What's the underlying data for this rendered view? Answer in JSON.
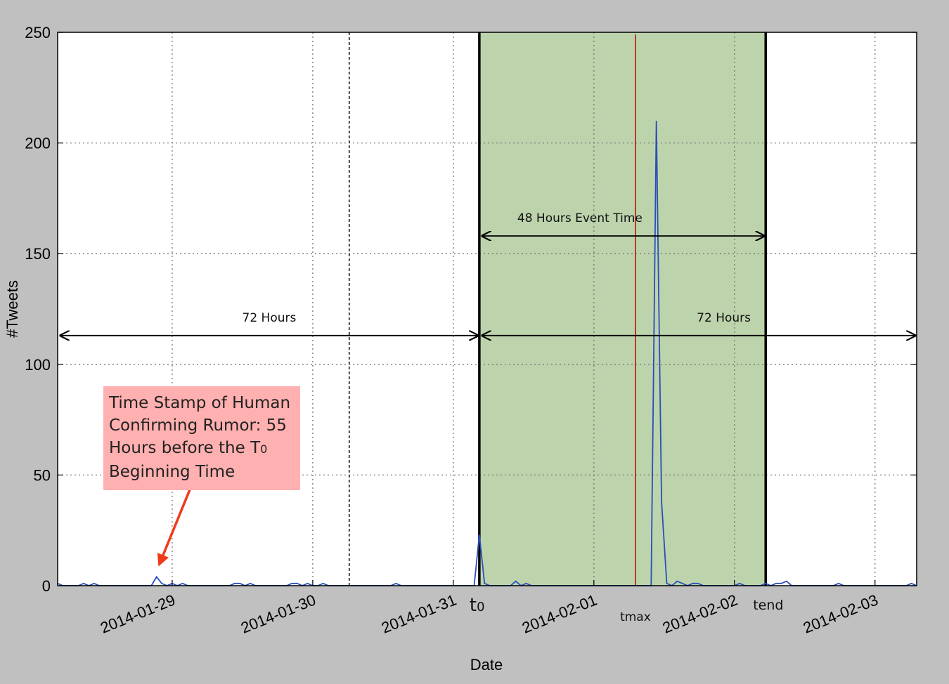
{
  "chart_data": {
    "type": "line",
    "title": "",
    "xlabel": "Date",
    "ylabel": "#Tweets",
    "ylim": [
      0,
      250
    ],
    "yticks": [
      0,
      50,
      100,
      150,
      200,
      250
    ],
    "xlim_hours": [
      0,
      165
    ],
    "xticks": [
      {
        "label": "2014-01-29",
        "hour": 22
      },
      {
        "label": "2014-01-30",
        "hour": 49
      },
      {
        "label": "2014-01-31",
        "hour": 76
      },
      {
        "label": "2014-02-01",
        "hour": 103
      },
      {
        "label": "2014-02-02",
        "hour": 130
      },
      {
        "label": "2014-02-03",
        "hour": 157
      }
    ],
    "grid": true,
    "series": [
      {
        "name": "",
        "color": "#2a4fb8",
        "x": [
          0,
          1,
          2,
          3,
          4,
          5,
          6,
          7,
          8,
          9,
          10,
          11,
          12,
          13,
          14,
          15,
          16,
          17,
          18,
          19,
          20,
          21,
          22,
          23,
          24,
          25,
          26,
          27,
          28,
          29,
          30,
          31,
          32,
          33,
          34,
          35,
          36,
          37,
          38,
          39,
          40,
          41,
          42,
          43,
          44,
          45,
          46,
          47,
          48,
          49,
          50,
          51,
          52,
          53,
          54,
          55,
          56,
          57,
          58,
          59,
          60,
          61,
          62,
          63,
          64,
          65,
          66,
          67,
          68,
          69,
          70,
          71,
          72,
          73,
          74,
          75,
          76,
          77,
          78,
          79,
          80,
          81,
          82,
          83,
          84,
          85,
          86,
          87,
          88,
          89,
          90,
          91,
          92,
          93,
          94,
          95,
          96,
          97,
          98,
          99,
          100,
          101,
          102,
          103,
          104,
          105,
          106,
          107,
          108,
          109,
          110,
          111,
          112,
          113,
          114,
          115,
          116,
          117,
          118,
          119,
          120,
          121,
          122,
          123,
          124,
          125,
          126,
          127,
          128,
          129,
          130,
          131,
          132,
          133,
          134,
          135,
          136,
          137,
          138,
          139,
          140,
          141,
          142,
          143,
          144,
          145,
          146,
          147,
          148,
          149,
          150,
          151,
          152,
          153,
          154,
          155,
          156,
          157,
          158,
          159,
          160,
          161,
          162,
          163,
          164,
          165
        ],
        "y": [
          1,
          0,
          0,
          0,
          0,
          1,
          0,
          1,
          0,
          0,
          0,
          0,
          0,
          0,
          0,
          0,
          0,
          0,
          0,
          4,
          1,
          0,
          1,
          0,
          1,
          0,
          0,
          0,
          0,
          0,
          0,
          0,
          0,
          0,
          1,
          1,
          0,
          1,
          0,
          0,
          0,
          0,
          0,
          0,
          0,
          1,
          1,
          0,
          1,
          0,
          0,
          1,
          0,
          0,
          0,
          0,
          0,
          0,
          0,
          0,
          0,
          0,
          0,
          0,
          0,
          1,
          0,
          0,
          0,
          0,
          0,
          0,
          0,
          0,
          0,
          0,
          0,
          0,
          0,
          0,
          0,
          23,
          1,
          0,
          0,
          0,
          0,
          0,
          2,
          0,
          1,
          0,
          0,
          0,
          0,
          0,
          0,
          0,
          0,
          0,
          0,
          0,
          0,
          0,
          0,
          0,
          0,
          0,
          0,
          0,
          0,
          0,
          0,
          0,
          0,
          210,
          38,
          1,
          0,
          2,
          1,
          0,
          1,
          1,
          0,
          0,
          0,
          0,
          0,
          0,
          0,
          1,
          0,
          0,
          0,
          0,
          1,
          0,
          1,
          1,
          2,
          0,
          0,
          0,
          0,
          0,
          0,
          0,
          0,
          0,
          1,
          0,
          0,
          0,
          0,
          0,
          0,
          0,
          0,
          0,
          0,
          0,
          0,
          0,
          1,
          0
        ]
      }
    ],
    "event_window": {
      "start_hour": 81,
      "end_hour": 136,
      "color": "#bcd3ac"
    },
    "peak_line": {
      "hour": 111,
      "color": "#b03018"
    },
    "dashed_line_hour": 56,
    "markers": [
      {
        "base": "t",
        "sub": "0",
        "hour": 81
      },
      {
        "base": "t",
        "sub": "max",
        "hour": 111
      },
      {
        "base": "t",
        "sub": "end",
        "hour": 136
      }
    ],
    "annotations": [
      {
        "label": "72 Hours",
        "y": 113,
        "from_hour": 0,
        "to_hour": 81
      },
      {
        "label": "48 Hours Event Time",
        "y": 158,
        "from_hour": 81,
        "to_hour": 136
      },
      {
        "label": "72 Hours",
        "y": 113,
        "from_hour": 81,
        "to_hour": 165
      }
    ],
    "callout": {
      "lines": [
        "Time Stamp of Human",
        "Confirming Rumor: 55",
        "Hours before the T",
        "Beginning Time"
      ],
      "subscript": "0",
      "arrow_to_hour": 19,
      "arrow_to_y": 4
    }
  }
}
